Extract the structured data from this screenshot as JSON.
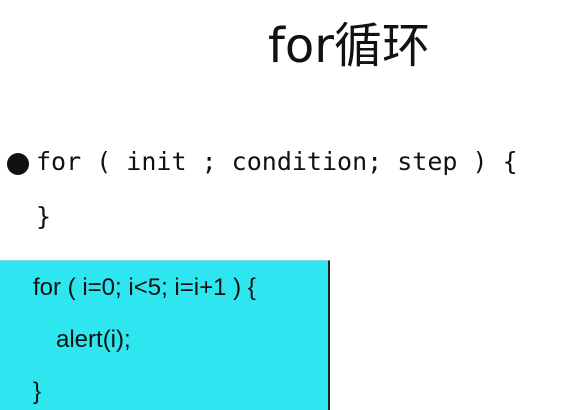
{
  "slide": {
    "title": "for循环",
    "syntax": {
      "line1": "for ( init ; condition; step ) {",
      "line2": "}"
    },
    "example": {
      "line1": "for ( i=0; i<5; i=i+1 ) {",
      "line2": "alert(i);",
      "line3": "}"
    },
    "colors": {
      "example_background": "#2ee6f0",
      "text": "#111111"
    }
  }
}
